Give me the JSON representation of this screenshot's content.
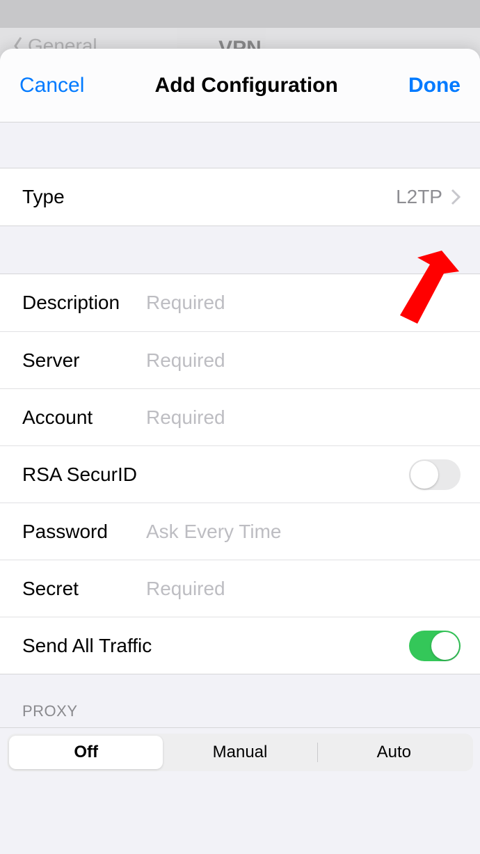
{
  "background": {
    "back_label": "General",
    "title": "VPN"
  },
  "modal": {
    "cancel": "Cancel",
    "title": "Add Configuration",
    "done": "Done"
  },
  "type_row": {
    "label": "Type",
    "value": "L2TP"
  },
  "fields": {
    "description": {
      "label": "Description",
      "placeholder": "Required",
      "value": ""
    },
    "server": {
      "label": "Server",
      "placeholder": "Required",
      "value": ""
    },
    "account": {
      "label": "Account",
      "placeholder": "Required",
      "value": ""
    },
    "rsa": {
      "label": "RSA SecurID",
      "on": false
    },
    "password": {
      "label": "Password",
      "placeholder": "Ask Every Time",
      "value": ""
    },
    "secret": {
      "label": "Secret",
      "placeholder": "Required",
      "value": ""
    },
    "send_all": {
      "label": "Send All Traffic",
      "on": true
    }
  },
  "proxy": {
    "section_label": "PROXY",
    "options": [
      "Off",
      "Manual",
      "Auto"
    ],
    "selected_index": 0
  }
}
